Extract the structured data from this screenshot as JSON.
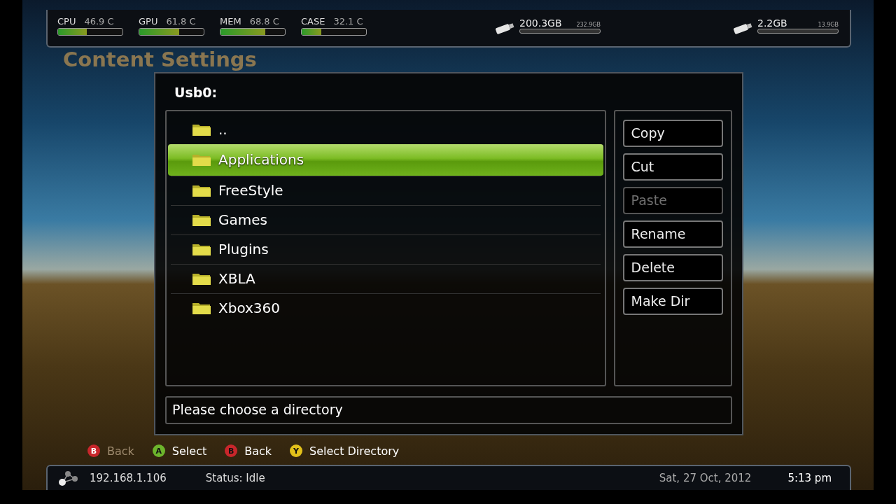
{
  "top_bar": {
    "meters": [
      {
        "label": "CPU",
        "reading": "46.9 C",
        "level": 0.45
      },
      {
        "label": "GPU",
        "reading": "61.8 C",
        "level": 0.62
      },
      {
        "label": "MEM",
        "reading": "68.8 C",
        "level": 0.7
      },
      {
        "label": "CASE",
        "reading": "32.1 C",
        "level": 0.3
      }
    ],
    "drives": [
      {
        "free": "200.3GB",
        "total": "232.9GB"
      },
      {
        "free": "2.2GB",
        "total": "13.9GB"
      }
    ]
  },
  "page_title": "Content Settings",
  "dialog": {
    "title": "Usb0:",
    "items": [
      {
        "name": "..",
        "selected": false
      },
      {
        "name": "Applications",
        "selected": true
      },
      {
        "name": "FreeStyle",
        "selected": false
      },
      {
        "name": "Games",
        "selected": false
      },
      {
        "name": "Plugins",
        "selected": false
      },
      {
        "name": "XBLA",
        "selected": false
      },
      {
        "name": "Xbox360",
        "selected": false
      }
    ],
    "actions": [
      {
        "label": "Copy",
        "disabled": false
      },
      {
        "label": "Cut",
        "disabled": false
      },
      {
        "label": "Paste",
        "disabled": true
      },
      {
        "label": "Rename",
        "disabled": false
      },
      {
        "label": "Delete",
        "disabled": false
      },
      {
        "label": "Make Dir",
        "disabled": false
      }
    ],
    "message": "Please choose a directory"
  },
  "hints": [
    {
      "key": "B",
      "color": "#c8262b",
      "label": "Back",
      "disabled": true
    },
    {
      "key": "A",
      "color": "#6db52c",
      "label": "Select",
      "disabled": false
    },
    {
      "key": "B",
      "color": "#c8262b",
      "label": "Back",
      "disabled": false
    },
    {
      "key": "Y",
      "color": "#e3c11a",
      "label": "Select Directory",
      "disabled": false
    }
  ],
  "status_bar": {
    "ip": "192.168.1.106",
    "status": "Status: Idle",
    "date": "Sat, 27 Oct, 2012",
    "time": "5:13 pm"
  }
}
